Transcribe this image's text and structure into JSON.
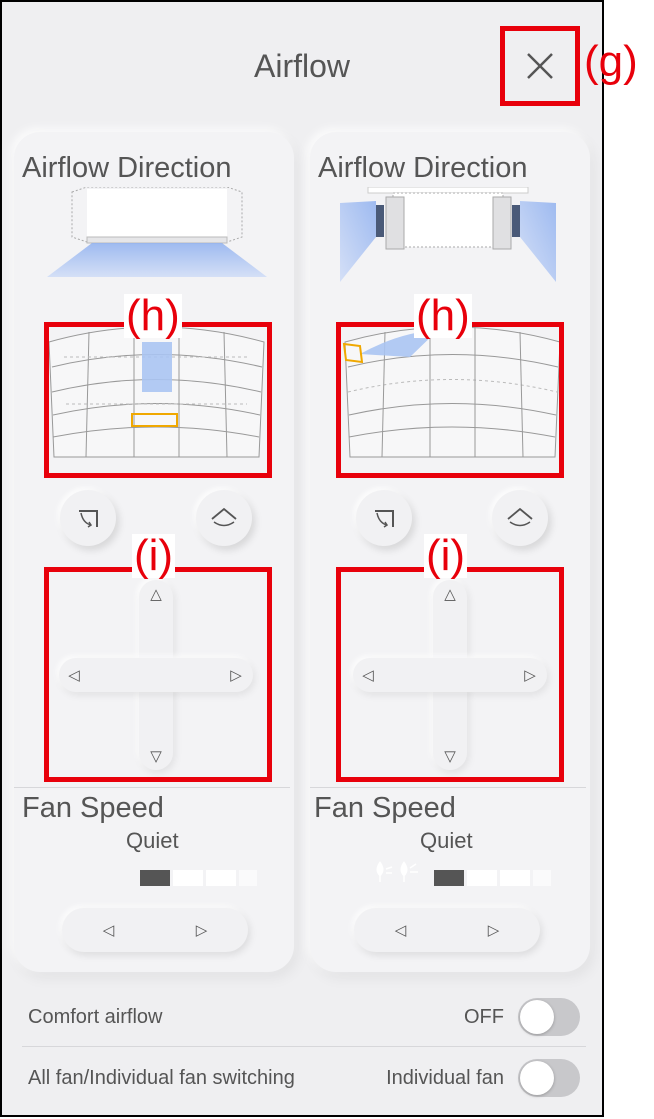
{
  "header": {
    "title": "Airflow"
  },
  "callouts": {
    "close": "(g)",
    "louver": "(h)",
    "dpad": "(i)"
  },
  "units": [
    {
      "airflow_title": "Airflow Direction",
      "fan_label": "Fan Speed",
      "fan_value": "Quiet",
      "fan_level": 1,
      "fan_levels_total": 4
    },
    {
      "airflow_title": "Airflow Direction",
      "fan_label": "Fan Speed",
      "fan_value": "Quiet",
      "fan_level": 1,
      "fan_levels_total": 4
    }
  ],
  "settings": {
    "comfort_label": "Comfort airflow",
    "comfort_status": "OFF",
    "switching_label": "All fan/Individual fan switching",
    "switching_status": "Individual fan"
  },
  "icons": {
    "close": "close-icon",
    "swing_vertical": "swing-vertical-icon",
    "swing_horizontal": "swing-horizontal-icon",
    "arrow_up": "arrow-up-icon",
    "arrow_down": "arrow-down-icon",
    "arrow_left": "arrow-left-icon",
    "arrow_right": "arrow-right-icon",
    "fan_leaf": "quiet-leaf-icon"
  },
  "colors": {
    "callout_red": "#e8000b",
    "selection_orange": "#f0a800",
    "airflow_blue": "#aac4f2"
  }
}
